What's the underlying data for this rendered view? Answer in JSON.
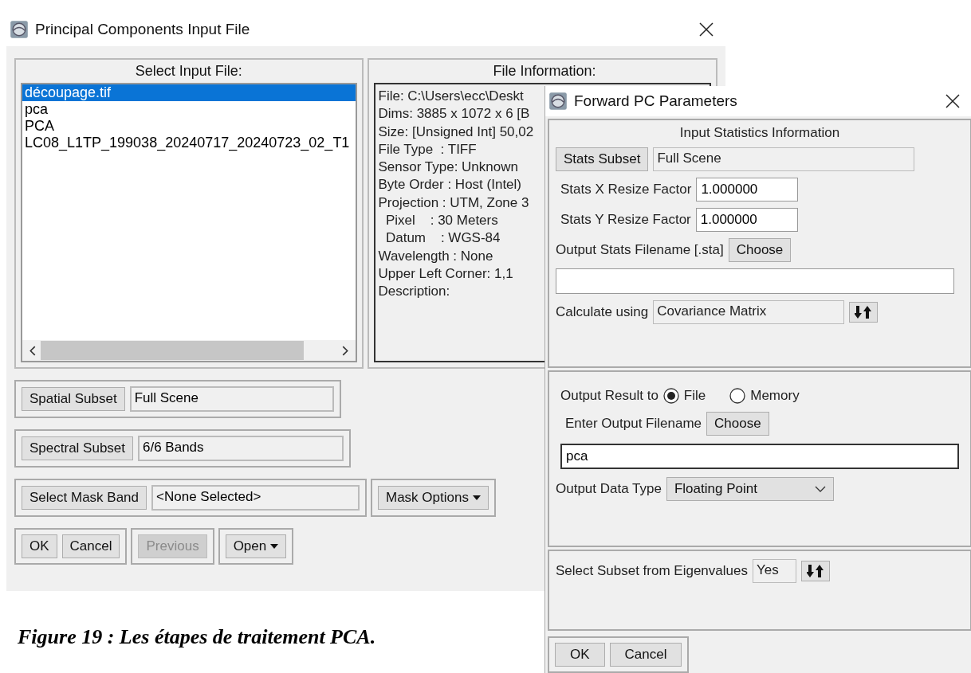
{
  "input_window": {
    "title": "Principal Components Input File",
    "file_list": {
      "heading": "Select Input File:",
      "items": [
        {
          "label": "découpage.tif",
          "selected": true
        },
        {
          "label": "pca",
          "selected": false
        },
        {
          "label": "PCA",
          "selected": false
        },
        {
          "label": "LC08_L1TP_199038_20240717_20240723_02_T1",
          "selected": false
        }
      ]
    },
    "file_info": {
      "heading": "File Information:",
      "lines": [
        "File: C:\\Users\\ecc\\Deskt",
        "Dims: 3885 x 1072 x 6 [B",
        "Size: [Unsigned Int] 50,02",
        "File Type  : TIFF",
        "Sensor Type: Unknown",
        "Byte Order : Host (Intel)",
        "Projection : UTM, Zone 3",
        "  Pixel    : 30 Meters",
        "  Datum    : WGS-84",
        "Wavelength : None",
        "Upper Left Corner: 1,1",
        "Description:"
      ]
    },
    "subsets": [
      {
        "button": "Spatial Subset",
        "value": "Full Scene"
      },
      {
        "button": "Spectral Subset",
        "value": "6/6 Bands"
      },
      {
        "button": "Select Mask Band",
        "value": "<None Selected>"
      }
    ],
    "mask_options": {
      "label": "Mask Options",
      "kind": "menu"
    },
    "button_groups": [
      [
        {
          "label": "OK",
          "disabled": false,
          "kind": "plain"
        },
        {
          "label": "Cancel",
          "disabled": false,
          "kind": "plain"
        }
      ],
      [
        {
          "label": "Previous",
          "disabled": true,
          "kind": "plain"
        }
      ],
      [
        {
          "label": "Open",
          "disabled": false,
          "kind": "menu"
        }
      ]
    ]
  },
  "pc_window": {
    "title": "Forward PC Parameters",
    "statistics": {
      "heading": "Input Statistics Information",
      "stats_subset": {
        "button": "Stats Subset",
        "value": "Full Scene"
      },
      "x_resize": {
        "label": "Stats X Resize Factor",
        "value": "1.000000"
      },
      "y_resize": {
        "label": "Stats Y Resize Factor",
        "value": "1.000000"
      },
      "stats_file": {
        "label": "Output Stats Filename [.sta]",
        "button": "Choose"
      },
      "calculate_using": {
        "label": "Calculate using",
        "value": "Covariance Matrix"
      }
    },
    "output": {
      "label": "Output Result to",
      "options": [
        {
          "label": "File",
          "selected": true
        },
        {
          "label": "Memory",
          "selected": false
        }
      ],
      "filename": {
        "label": "Enter Output Filename",
        "button": "Choose",
        "value": "pca"
      },
      "data_type": {
        "label": "Output Data Type",
        "value": "Floating Point"
      }
    },
    "eigenvalues": {
      "label": "Select Subset from Eigenvalues",
      "value": "Yes"
    },
    "buttons": [
      {
        "label": "OK"
      },
      {
        "label": "Cancel"
      }
    ]
  },
  "caption": "Figure 19 : Les étapes de traitement PCA."
}
